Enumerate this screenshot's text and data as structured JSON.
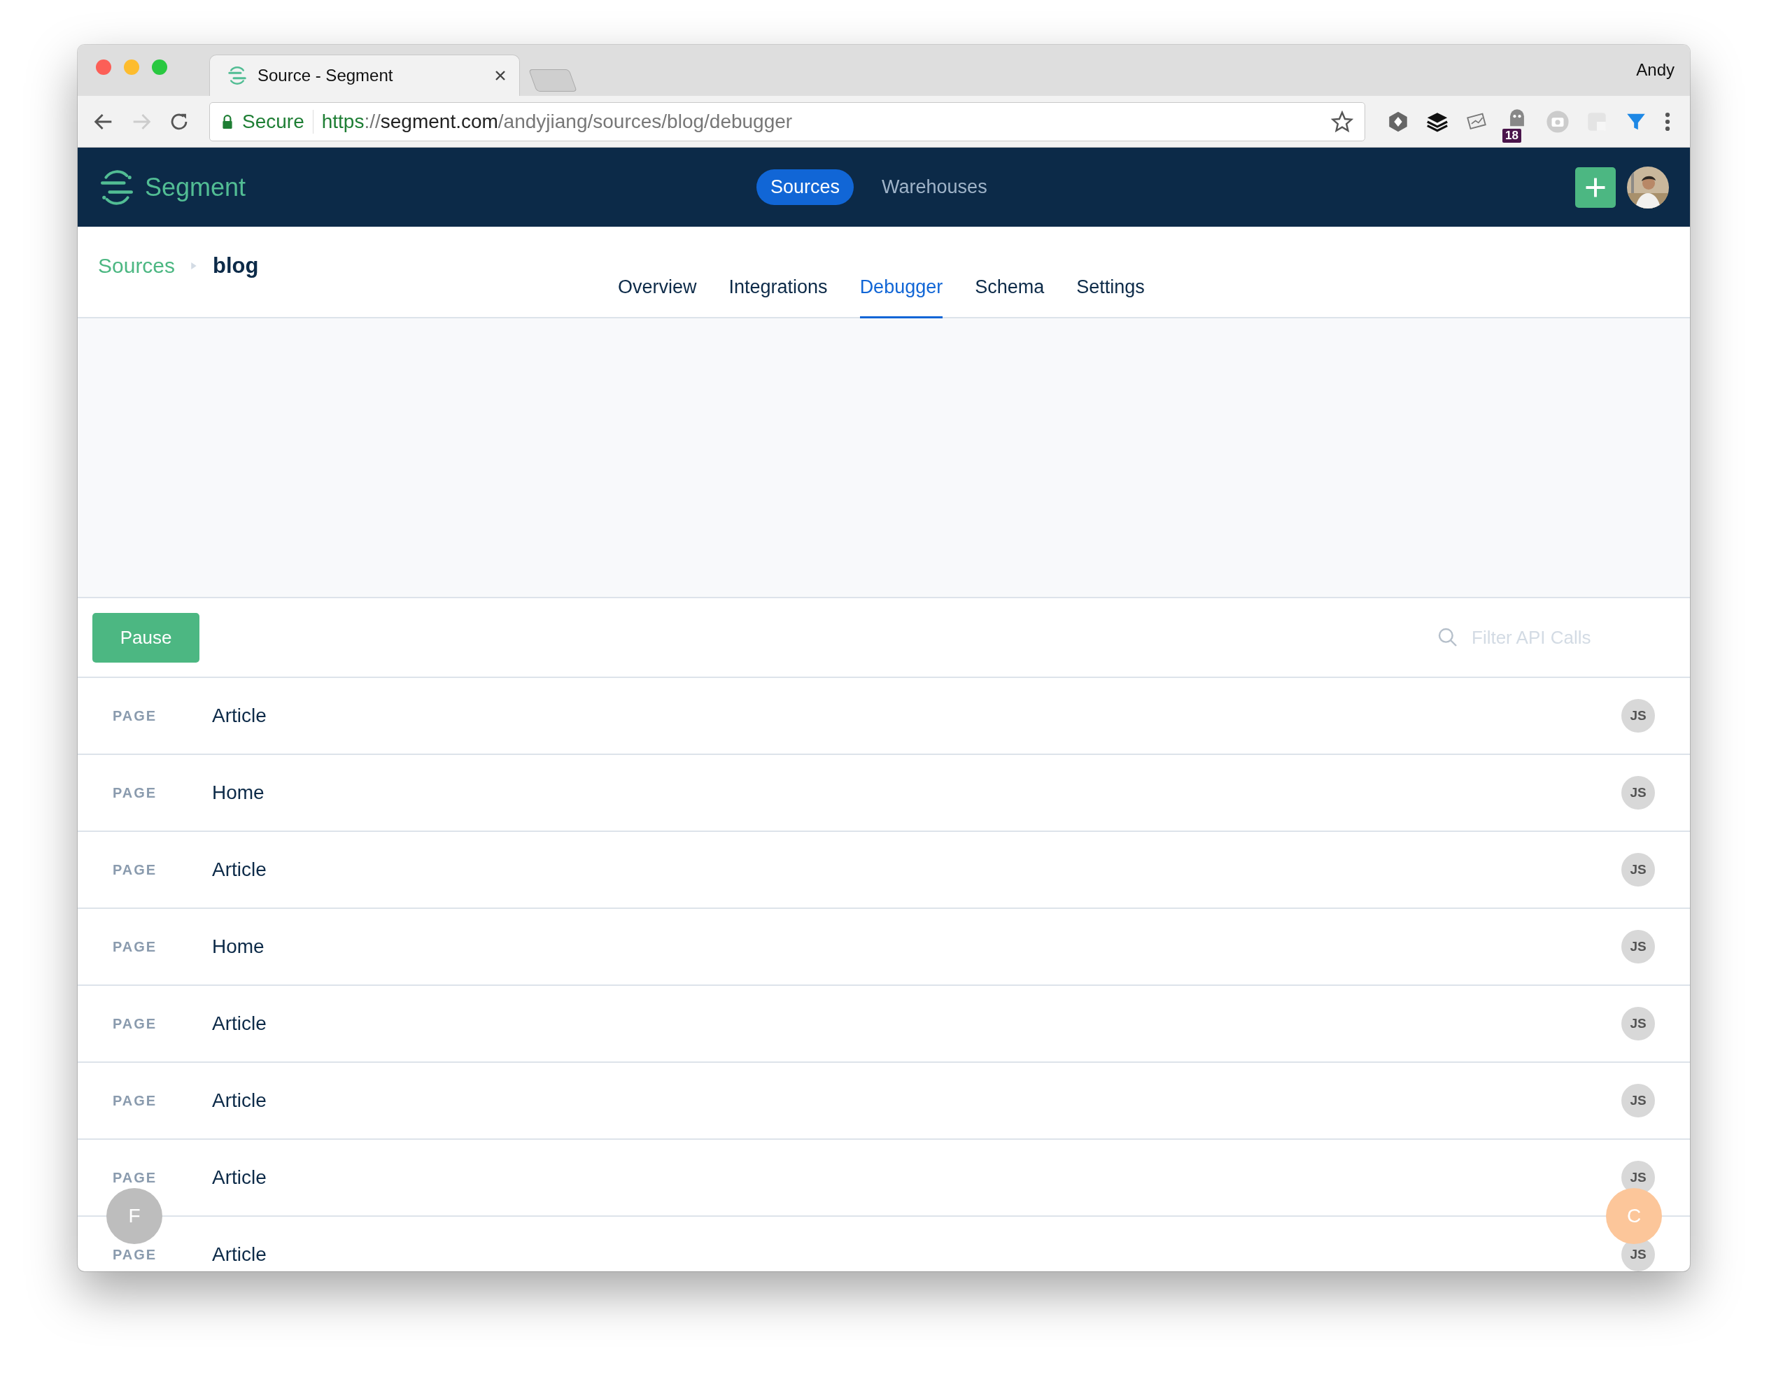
{
  "browser": {
    "tab": {
      "title": "Source - Segment"
    },
    "profile": "Andy",
    "address": {
      "secure_label": "Secure",
      "url_parts": [
        {
          "text": "https",
          "kind": "scheme"
        },
        {
          "text": "://",
          "kind": "plain"
        },
        {
          "text": "segment.com",
          "kind": "host"
        },
        {
          "text": "/andyjiang/sources/blog/debugger",
          "kind": "plain"
        }
      ]
    },
    "extension_badge": "18"
  },
  "header": {
    "logo": "Segment",
    "nav": [
      {
        "label": "Sources",
        "selected": true
      },
      {
        "label": "Warehouses",
        "selected": false
      }
    ]
  },
  "breadcrumb": {
    "parent": "Sources",
    "current": "blog"
  },
  "tabs": [
    {
      "label": "Overview",
      "selected": false
    },
    {
      "label": "Integrations",
      "selected": false
    },
    {
      "label": "Debugger",
      "selected": true
    },
    {
      "label": "Schema",
      "selected": false
    },
    {
      "label": "Settings",
      "selected": false
    }
  ],
  "toolbar": {
    "pause_button": "Pause",
    "filter": {
      "placeholder": "Filter API Calls"
    }
  },
  "events": [
    {
      "type": "PAGE",
      "name": "Article",
      "library": "JS"
    },
    {
      "type": "PAGE",
      "name": "Home",
      "library": "JS"
    },
    {
      "type": "PAGE",
      "name": "Article",
      "library": "JS"
    },
    {
      "type": "PAGE",
      "name": "Home",
      "library": "JS"
    },
    {
      "type": "PAGE",
      "name": "Article",
      "library": "JS"
    },
    {
      "type": "PAGE",
      "name": "Article",
      "library": "JS"
    },
    {
      "type": "PAGE",
      "name": "Article",
      "library": "JS"
    },
    {
      "type": "PAGE",
      "name": "Article",
      "library": "JS"
    }
  ],
  "floating": [
    {
      "label": "F",
      "color": "#bdbdbd"
    },
    {
      "label": "C",
      "color": "#fcc69a"
    }
  ]
}
